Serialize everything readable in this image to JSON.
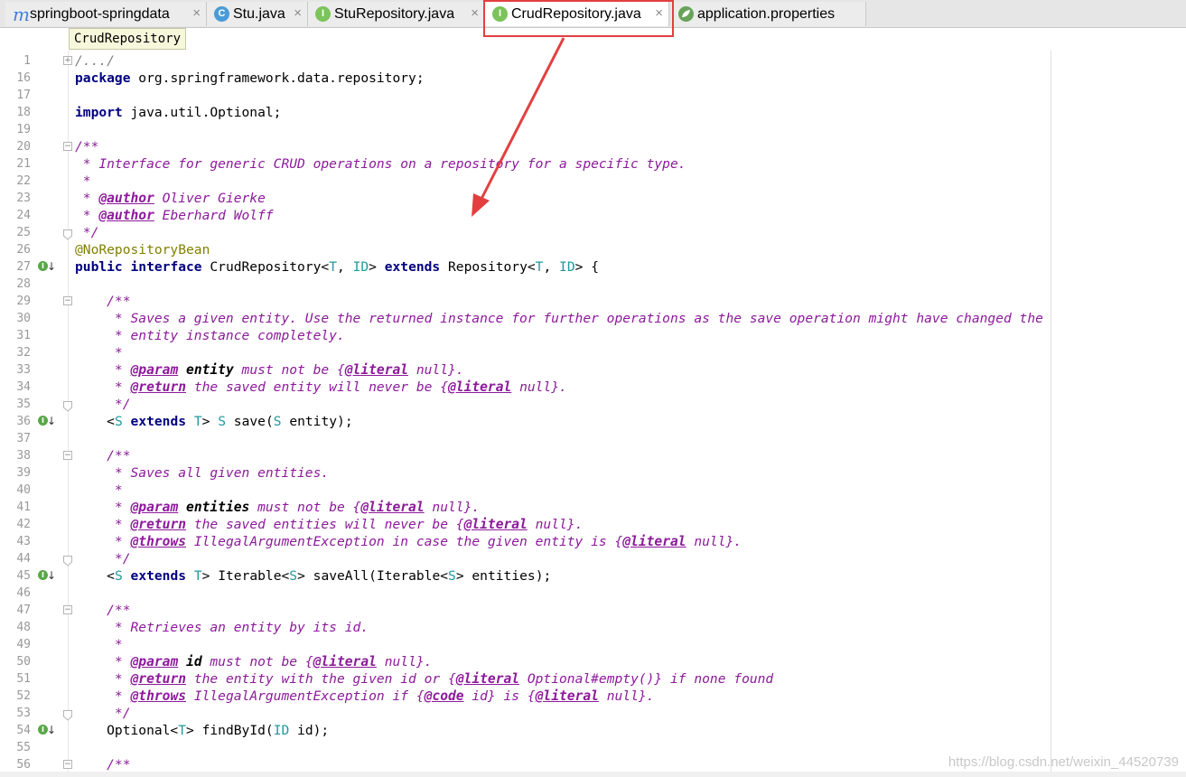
{
  "tabs": [
    {
      "label": "springboot-springdata",
      "icon": "maven-module-icon",
      "active": false
    },
    {
      "label": "Stu.java",
      "icon": "class-icon",
      "active": false
    },
    {
      "label": "StuRepository.java",
      "icon": "interface-icon",
      "active": false
    },
    {
      "label": "CrudRepository.java",
      "icon": "interface-locked-icon",
      "active": true
    },
    {
      "label": "application.properties",
      "icon": "spring-properties-icon",
      "active": false
    }
  ],
  "tooltip": "CrudRepository",
  "icons": {
    "m": "m",
    "c": "C",
    "i": "I",
    "close": "×"
  },
  "colors": {
    "highlight_box": "#e33f3f",
    "arrow": "#e33f3f",
    "keyword": "#000080",
    "javadoc": "#8c1a9a",
    "type_param": "#20999d",
    "annotation": "#808000"
  },
  "lines": [
    {
      "n": "1",
      "text": "/.../"
    },
    {
      "n": "16",
      "text": "package org.springframework.data.repository;"
    },
    {
      "n": "17",
      "text": ""
    },
    {
      "n": "18",
      "text": "import java.util.Optional;"
    },
    {
      "n": "19",
      "text": ""
    },
    {
      "n": "20",
      "text": "/**"
    },
    {
      "n": "21",
      "text": " * Interface for generic CRUD operations on a repository for a specific type."
    },
    {
      "n": "22",
      "text": " *"
    },
    {
      "n": "23",
      "text": " * @author Oliver Gierke"
    },
    {
      "n": "24",
      "text": " * @author Eberhard Wolff"
    },
    {
      "n": "25",
      "text": " */"
    },
    {
      "n": "26",
      "text": "@NoRepositoryBean"
    },
    {
      "n": "27",
      "text": "public interface CrudRepository<T, ID> extends Repository<T, ID> {"
    },
    {
      "n": "28",
      "text": ""
    },
    {
      "n": "29",
      "text": "    /**"
    },
    {
      "n": "30",
      "text": "     * Saves a given entity. Use the returned instance for further operations as the save operation might have changed the"
    },
    {
      "n": "31",
      "text": "     * entity instance completely."
    },
    {
      "n": "32",
      "text": "     *"
    },
    {
      "n": "33",
      "text": "     * @param entity must not be {@literal null}."
    },
    {
      "n": "34",
      "text": "     * @return the saved entity will never be {@literal null}."
    },
    {
      "n": "35",
      "text": "     */"
    },
    {
      "n": "36",
      "text": "    <S extends T> S save(S entity);"
    },
    {
      "n": "37",
      "text": ""
    },
    {
      "n": "38",
      "text": "    /**"
    },
    {
      "n": "39",
      "text": "     * Saves all given entities."
    },
    {
      "n": "40",
      "text": "     *"
    },
    {
      "n": "41",
      "text": "     * @param entities must not be {@literal null}."
    },
    {
      "n": "42",
      "text": "     * @return the saved entities will never be {@literal null}."
    },
    {
      "n": "43",
      "text": "     * @throws IllegalArgumentException in case the given entity is {@literal null}."
    },
    {
      "n": "44",
      "text": "     */"
    },
    {
      "n": "45",
      "text": "    <S extends T> Iterable<S> saveAll(Iterable<S> entities);"
    },
    {
      "n": "46",
      "text": ""
    },
    {
      "n": "47",
      "text": "    /**"
    },
    {
      "n": "48",
      "text": "     * Retrieves an entity by its id."
    },
    {
      "n": "49",
      "text": "     *"
    },
    {
      "n": "50",
      "text": "     * @param id must not be {@literal null}."
    },
    {
      "n": "51",
      "text": "     * @return the entity with the given id or {@literal Optional#empty()} if none found"
    },
    {
      "n": "52",
      "text": "     * @throws IllegalArgumentException if {@code id} is {@literal null}."
    },
    {
      "n": "53",
      "text": "     */"
    },
    {
      "n": "54",
      "text": "    Optional<T> findById(ID id);"
    },
    {
      "n": "55",
      "text": ""
    },
    {
      "n": "56",
      "text": "    /**"
    }
  ],
  "watermark": "https://blog.csdn.net/weixin_44520739"
}
